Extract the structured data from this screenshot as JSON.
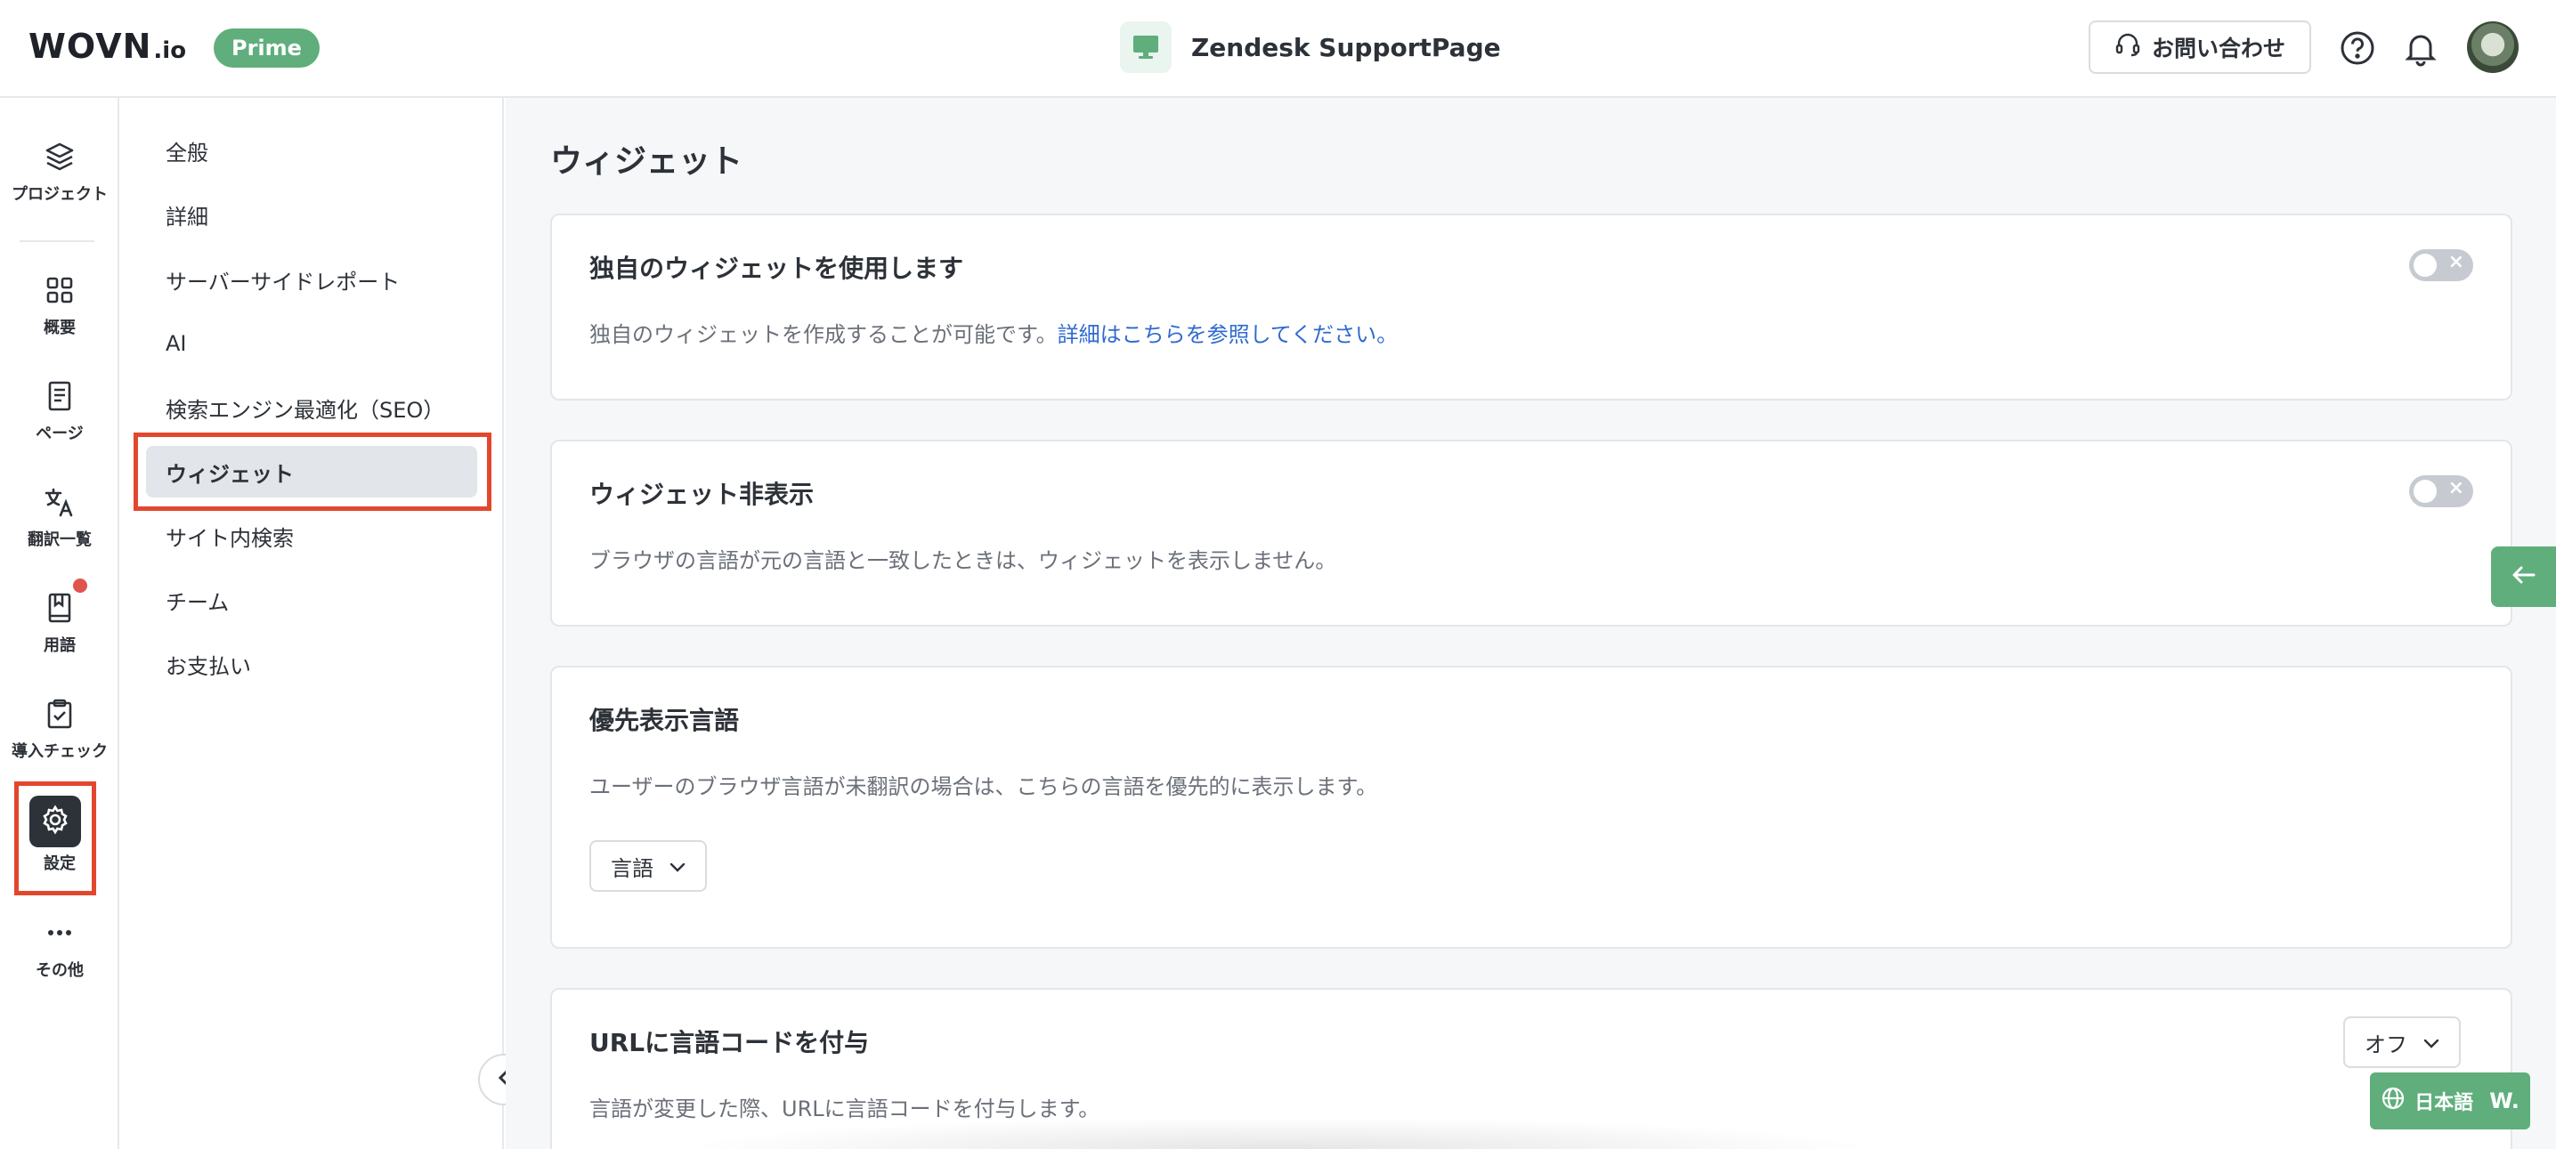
{
  "header": {
    "logo_main": "WOVN",
    "logo_suffix": ".io",
    "plan_badge": "Prime",
    "project_name": "Zendesk SupportPage",
    "contact_label": "お問い合わせ",
    "icons": [
      "monitor-icon",
      "headset-icon",
      "help-icon",
      "bell-icon"
    ]
  },
  "rail": {
    "items": [
      {
        "label": "プロジェクト",
        "icon": "layers-icon"
      },
      {
        "label": "概要",
        "icon": "grid-icon"
      },
      {
        "label": "ページ",
        "icon": "page-icon"
      },
      {
        "label": "翻訳一覧",
        "icon": "translate-icon"
      },
      {
        "label": "用語",
        "icon": "book-icon"
      },
      {
        "label": "導入チェック",
        "icon": "clipboard-check-icon"
      },
      {
        "label": "設定",
        "icon": "gear-icon"
      },
      {
        "label": "その他",
        "icon": "more-icon"
      }
    ]
  },
  "subnav": {
    "items": [
      {
        "label": "全般"
      },
      {
        "label": "詳細"
      },
      {
        "label": "サーバーサイドレポート"
      },
      {
        "label": "AI"
      },
      {
        "label": "検索エンジン最適化（SEO）"
      },
      {
        "label": "ウィジェット"
      },
      {
        "label": "サイト内検索"
      },
      {
        "label": "チーム"
      },
      {
        "label": "お支払い"
      }
    ],
    "active": "ウィジェット"
  },
  "main": {
    "title": "ウィジェット",
    "cards": [
      {
        "title": "独自のウィジェットを使用します",
        "desc": "独自のウィジェットを作成することが可能です。",
        "link": "詳細はこちらを参照してください。",
        "toggle": "off"
      },
      {
        "title": "ウィジェット非表示",
        "desc": "ブラウザの言語が元の言語と一致したときは、ウィジェットを表示しません。",
        "toggle": "off"
      },
      {
        "title": "優先表示言語",
        "desc": "ユーザーのブラウザ言語が未翻訳の場合は、こちらの言語を優先的に表示します。",
        "select_value": "言語"
      },
      {
        "title": "URLに言語コードを付与",
        "desc": "言語が変更した際、URLに言語コードを付与します。",
        "select_value": "オフ"
      }
    ]
  },
  "widget": {
    "lang_label": "日本語",
    "brand": "W."
  },
  "colors": {
    "accent_green": "#5fae7c",
    "highlight_red": "#e2472d",
    "link_blue": "#2f6ad0",
    "dark": "#2d3138"
  }
}
